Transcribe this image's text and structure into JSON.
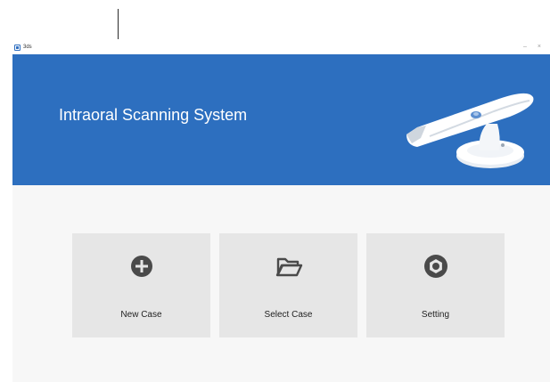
{
  "window": {
    "app_name": "3ds",
    "minimize_label": "–",
    "close_label": "×"
  },
  "banner": {
    "title": "Intraoral Scanning System"
  },
  "tiles": [
    {
      "label": "New Case",
      "icon": "plus-circle-icon"
    },
    {
      "label": "Select Case",
      "icon": "folder-open-icon"
    },
    {
      "label": "Setting",
      "icon": "gear-icon"
    }
  ],
  "colors": {
    "banner_blue": "#2d6fbf",
    "tile_bg": "#e6e6e6",
    "icon_dark": "#4a4a4a"
  }
}
